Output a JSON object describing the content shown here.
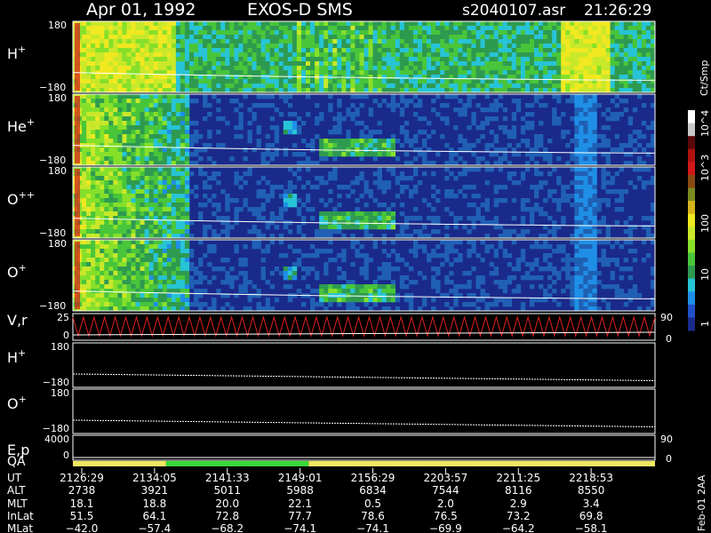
{
  "header": {
    "date": "Apr 01, 1992",
    "instrument": "EXOS-D SMS",
    "file": "s2040107.asr",
    "time": "21:26:29"
  },
  "colorbar": {
    "title": "Ct/Smp",
    "tick_labels": [
      "1",
      "10",
      "100",
      "10^3",
      "10^4"
    ],
    "colors": [
      "#1a2a8a",
      "#1f50c8",
      "#1f8fe6",
      "#27c4d6",
      "#2e9a50",
      "#48c53a",
      "#86e02a",
      "#c9e82a",
      "#f0e820",
      "#d6b51c",
      "#7a8a20",
      "#8a4a12",
      "#d01818",
      "#b01010",
      "#5a0808",
      "#c8c8c8",
      "#ffffff"
    ]
  },
  "chart_data": {
    "type": "heatmap",
    "title": "",
    "colorscale": "log",
    "zlim": [
      1,
      10000
    ],
    "panels": [
      {
        "label": "H",
        "superscript": "+",
        "ylim": [
          -180,
          180
        ],
        "ticks": [
          "180",
          "−180"
        ],
        "background": "#2060b4",
        "activity": "high"
      },
      {
        "label": "He",
        "superscript": "+",
        "ylim": [
          -180,
          180
        ],
        "ticks": [
          "180",
          "−180"
        ],
        "background": "#1a2a8a",
        "activity": "medium"
      },
      {
        "label": "O",
        "superscript": "++",
        "ylim": [
          -180,
          180
        ],
        "ticks": [
          "180",
          "−180"
        ],
        "background": "#1a2a8a",
        "activity": "medium"
      },
      {
        "label": "O",
        "superscript": "+",
        "ylim": [
          -180,
          180
        ],
        "ticks": [
          "180",
          "−180"
        ],
        "background": "#1a2a8a",
        "activity": "medium"
      }
    ],
    "line_panels": [
      {
        "label": "V,r",
        "left_ticks": [
          "25",
          "0"
        ],
        "right_ticks": [
          "90",
          "0"
        ]
      },
      {
        "label": "H",
        "superscript": "+",
        "left_ticks": [
          "180",
          "−180"
        ]
      },
      {
        "label": "O",
        "superscript": "+",
        "left_ticks": [
          "180",
          "−180"
        ]
      },
      {
        "label": "E,p",
        "left_ticks": [
          "4000",
          "0"
        ],
        "right_ticks": [
          "90",
          "0"
        ]
      }
    ],
    "qa": {
      "label": "QA",
      "segments": [
        {
          "from": 0,
          "to": 0.16,
          "color": "#f0e860"
        },
        {
          "from": 0.16,
          "to": 0.16,
          "color": "#ffffff"
        },
        {
          "from": 0.16,
          "to": 0.405,
          "color": "#3ad83a"
        },
        {
          "from": 0.405,
          "to": 1,
          "color": "#f0e860"
        }
      ]
    },
    "x_ticks": [
      "2126:29",
      "2134:05",
      "2141:33",
      "2149:01",
      "2156:29",
      "2203:57",
      "2211:25",
      "2218:53"
    ],
    "orbit_table": [
      {
        "name": "UT",
        "values": [
          "2126:29",
          "2134:05",
          "2141:33",
          "2149:01",
          "2156:29",
          "2203:57",
          "2211:25",
          "2218:53"
        ]
      },
      {
        "name": "ALT",
        "values": [
          "2738",
          "3921",
          "5011",
          "5988",
          "6834",
          "7544",
          "8116",
          "8550"
        ]
      },
      {
        "name": "MLT",
        "values": [
          "18.1",
          "18.8",
          "20.0",
          "22.1",
          "0.5",
          "2.0",
          "2.9",
          "3.4"
        ]
      },
      {
        "name": "InLat",
        "values": [
          "51.5",
          "64.1",
          "72.8",
          "77.7",
          "78.6",
          "76.5",
          "73.2",
          "69.8"
        ]
      },
      {
        "name": "MLat",
        "values": [
          "−42.0",
          "−57.4",
          "−68.2",
          "−74.1",
          "−74.1",
          "−69.9",
          "−64.2",
          "−58.1"
        ]
      }
    ]
  },
  "footer": {
    "side_label": "Feb-01 2AA"
  }
}
